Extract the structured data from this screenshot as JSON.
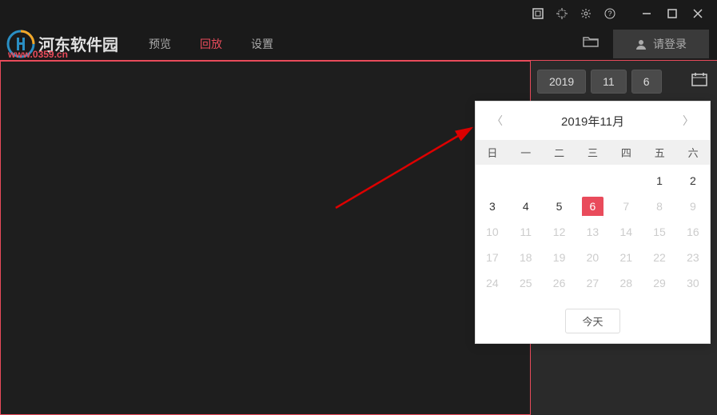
{
  "title": "河东软件园",
  "watermark": "www.0359.cn",
  "tabs": [
    "预览",
    "回放",
    "设置"
  ],
  "active_tab_index": 1,
  "login_label": "请登录",
  "date_selector": {
    "year": "2019",
    "month": "11",
    "day": "6"
  },
  "calendar": {
    "title": "2019年11月",
    "weekdays": [
      "日",
      "一",
      "二",
      "三",
      "四",
      "五",
      "六"
    ],
    "lead_blanks": 5,
    "days": 30,
    "selected": 6,
    "disabled_after": 6,
    "today_label": "今天"
  }
}
